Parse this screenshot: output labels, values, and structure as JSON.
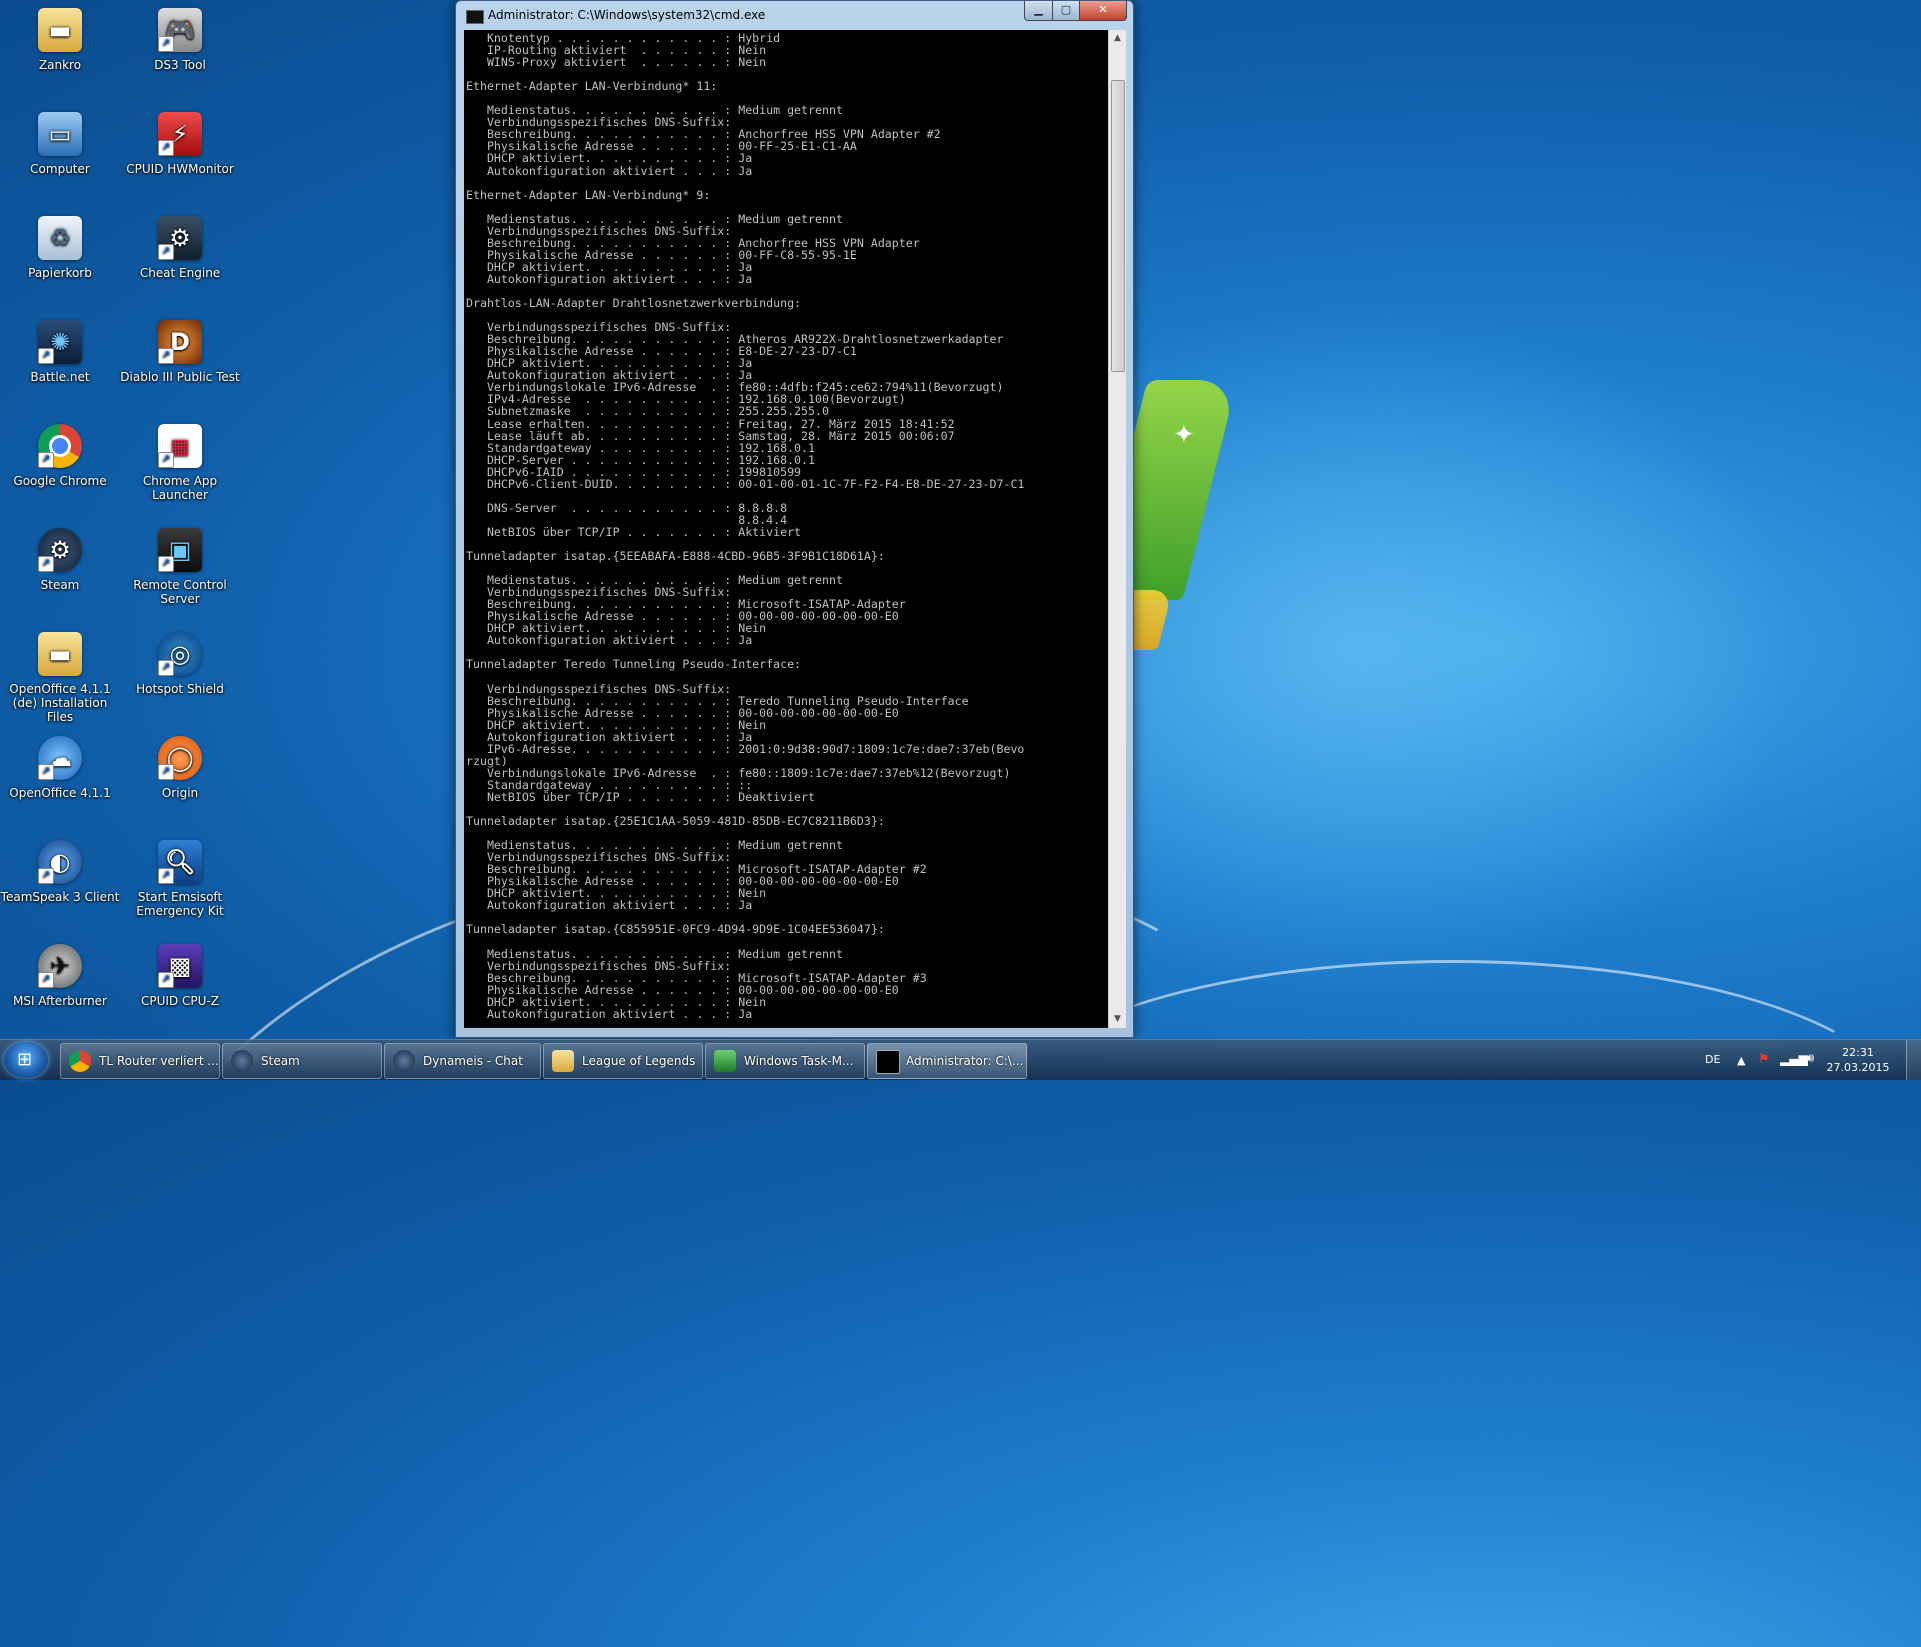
{
  "desktop_icons": [
    {
      "label": "Zankro",
      "icon": "folder-icon"
    },
    {
      "label": "DS3 Tool",
      "icon": "gamepad-icon"
    },
    {
      "label": "Computer",
      "icon": "computer-icon"
    },
    {
      "label": "CPUID HWMonitor",
      "icon": "hwmonitor-icon"
    },
    {
      "label": "Papierkorb",
      "icon": "recycle-bin-icon"
    },
    {
      "label": "Cheat Engine",
      "icon": "cheat-engine-icon"
    },
    {
      "label": "Battle.net",
      "icon": "battlenet-icon"
    },
    {
      "label": "Diablo III Public Test",
      "icon": "diablo-icon"
    },
    {
      "label": "Google Chrome",
      "icon": "chrome-icon"
    },
    {
      "label": "Chrome App Launcher",
      "icon": "app-launcher-icon"
    },
    {
      "label": "Steam",
      "icon": "steam-icon"
    },
    {
      "label": "Remote Control Server",
      "icon": "remote-control-icon"
    },
    {
      "label": "OpenOffice 4.1.1 (de) Installation Files",
      "icon": "folder-icon"
    },
    {
      "label": "Hotspot Shield",
      "icon": "hotspot-shield-icon"
    },
    {
      "label": "OpenOffice 4.1.1",
      "icon": "openoffice-icon"
    },
    {
      "label": "Origin",
      "icon": "origin-icon"
    },
    {
      "label": "TeamSpeak 3 Client",
      "icon": "teamspeak-icon"
    },
    {
      "label": "Start Emsisoft Emergency Kit",
      "icon": "emsisoft-icon"
    },
    {
      "label": "MSI Afterburner",
      "icon": "afterburner-icon"
    },
    {
      "label": "CPUID CPU-Z",
      "icon": "cpuz-icon"
    }
  ],
  "window": {
    "title": "Administrator: C:\\Windows\\system32\\cmd.exe",
    "console_lines": [
      "   Knotentyp . . . . . . . . . . . . : Hybrid",
      "   IP-Routing aktiviert  . . . . . . : Nein",
      "   WINS-Proxy aktiviert  . . . . . . : Nein",
      "",
      "Ethernet-Adapter LAN-Verbindung* 11:",
      "",
      "   Medienstatus. . . . . . . . . . . : Medium getrennt",
      "   Verbindungsspezifisches DNS-Suffix:",
      "   Beschreibung. . . . . . . . . . . : Anchorfree HSS VPN Adapter #2",
      "   Physikalische Adresse . . . . . . : 00-FF-25-E1-C1-AA",
      "   DHCP aktiviert. . . . . . . . . . : Ja",
      "   Autokonfiguration aktiviert . . . : Ja",
      "",
      "Ethernet-Adapter LAN-Verbindung* 9:",
      "",
      "   Medienstatus. . . . . . . . . . . : Medium getrennt",
      "   Verbindungsspezifisches DNS-Suffix:",
      "   Beschreibung. . . . . . . . . . . : Anchorfree HSS VPN Adapter",
      "   Physikalische Adresse . . . . . . : 00-FF-C8-55-95-1E",
      "   DHCP aktiviert. . . . . . . . . . : Ja",
      "   Autokonfiguration aktiviert . . . : Ja",
      "",
      "Drahtlos-LAN-Adapter Drahtlosnetzwerkverbindung:",
      "",
      "   Verbindungsspezifisches DNS-Suffix:",
      "   Beschreibung. . . . . . . . . . . : Atheros AR922X-Drahtlosnetzwerkadapter",
      "   Physikalische Adresse . . . . . . : E8-DE-27-23-D7-C1",
      "   DHCP aktiviert. . . . . . . . . . : Ja",
      "   Autokonfiguration aktiviert . . . : Ja",
      "   Verbindungslokale IPv6-Adresse  . : fe80::4dfb:f245:ce62:794%11(Bevorzugt)",
      "   IPv4-Adresse  . . . . . . . . . . : 192.168.0.100(Bevorzugt)",
      "   Subnetzmaske  . . . . . . . . . . : 255.255.255.0",
      "   Lease erhalten. . . . . . . . . . : Freitag, 27. März 2015 18:41:52",
      "   Lease läuft ab. . . . . . . . . . : Samstag, 28. März 2015 00:06:07",
      "   Standardgateway . . . . . . . . . : 192.168.0.1",
      "   DHCP-Server . . . . . . . . . . . : 192.168.0.1",
      "   DHCPv6-IAID . . . . . . . . . . . : 199810599",
      "   DHCPv6-Client-DUID. . . . . . . . : 00-01-00-01-1C-7F-F2-F4-E8-DE-27-23-D7-C1",
      "",
      "   DNS-Server  . . . . . . . . . . . : 8.8.8.8",
      "                                       8.8.4.4",
      "   NetBIOS über TCP/IP . . . . . . . : Aktiviert",
      "",
      "Tunneladapter isatap.{5EEABAFA-E888-4CBD-96B5-3F9B1C18D61A}:",
      "",
      "   Medienstatus. . . . . . . . . . . : Medium getrennt",
      "   Verbindungsspezifisches DNS-Suffix:",
      "   Beschreibung. . . . . . . . . . . : Microsoft-ISATAP-Adapter",
      "   Physikalische Adresse . . . . . . : 00-00-00-00-00-00-00-E0",
      "   DHCP aktiviert. . . . . . . . . . : Nein",
      "   Autokonfiguration aktiviert . . . : Ja",
      "",
      "Tunneladapter Teredo Tunneling Pseudo-Interface:",
      "",
      "   Verbindungsspezifisches DNS-Suffix:",
      "   Beschreibung. . . . . . . . . . . : Teredo Tunneling Pseudo-Interface",
      "   Physikalische Adresse . . . . . . : 00-00-00-00-00-00-00-E0",
      "   DHCP aktiviert. . . . . . . . . . : Nein",
      "   Autokonfiguration aktiviert . . . : Ja",
      "   IPv6-Adresse. . . . . . . . . . . : 2001:0:9d38:90d7:1809:1c7e:dae7:37eb(Bevo",
      "rzugt)",
      "   Verbindungslokale IPv6-Adresse  . : fe80::1809:1c7e:dae7:37eb%12(Bevorzugt)",
      "   Standardgateway . . . . . . . . . : ::",
      "   NetBIOS über TCP/IP . . . . . . . : Deaktiviert",
      "",
      "Tunneladapter isatap.{25E1C1AA-5059-481D-85DB-EC7C8211B6D3}:",
      "",
      "   Medienstatus. . . . . . . . . . . : Medium getrennt",
      "   Verbindungsspezifisches DNS-Suffix:",
      "   Beschreibung. . . . . . . . . . . : Microsoft-ISATAP-Adapter #2",
      "   Physikalische Adresse . . . . . . : 00-00-00-00-00-00-00-E0",
      "   DHCP aktiviert. . . . . . . . . . : Nein",
      "   Autokonfiguration aktiviert . . . : Ja",
      "",
      "Tunneladapter isatap.{C855951E-0FC9-4D94-9D9E-1C04EE536047}:",
      "",
      "   Medienstatus. . . . . . . . . . . : Medium getrennt",
      "   Verbindungsspezifisches DNS-Suffix:",
      "   Beschreibung. . . . . . . . . . . : Microsoft-ISATAP-Adapter #3",
      "   Physikalische Adresse . . . . . . : 00-00-00-00-00-00-00-E0",
      "   DHCP aktiviert. . . . . . . . . . : Nein",
      "   Autokonfiguration aktiviert . . . : Ja"
    ]
  },
  "taskbar": {
    "tasks": [
      {
        "label": "TL Router verliert ...",
        "icon": "chrome-icon",
        "active": false
      },
      {
        "label": "Steam",
        "icon": "steam-icon",
        "active": false
      },
      {
        "label": "Dynameis - Chat",
        "icon": "steam-icon",
        "active": false
      },
      {
        "label": "League of Legends",
        "icon": "folder-icon",
        "active": false
      },
      {
        "label": "Windows Task-M...",
        "icon": "task-manager-icon",
        "active": false
      },
      {
        "label": "Administrator: C:\\...",
        "icon": "cmd-icon",
        "active": true
      }
    ],
    "language": "DE",
    "time": "22:31",
    "date": "27.03.2015"
  },
  "colors": {
    "console_bg": "#000000",
    "console_fg": "#c0c0c0",
    "desktop_bg": "#1e7fcf"
  }
}
